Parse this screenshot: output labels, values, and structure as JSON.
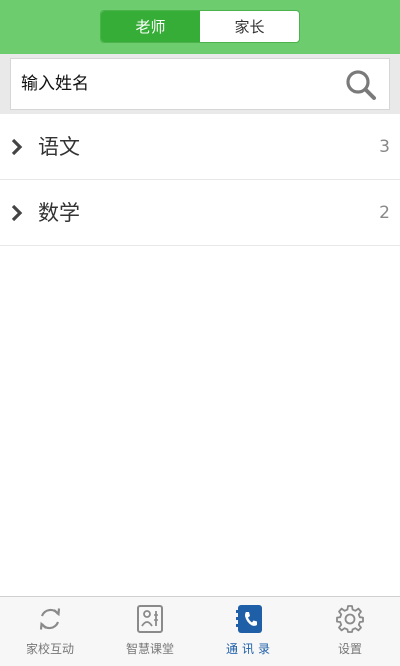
{
  "header": {
    "tabs": [
      {
        "label": "老师",
        "active": true
      },
      {
        "label": "家长",
        "active": false
      }
    ]
  },
  "search": {
    "placeholder": "输入姓名",
    "icon": "search-icon"
  },
  "groups": [
    {
      "label": "语文",
      "count": "3",
      "icon": "chevron-right-icon"
    },
    {
      "label": "数学",
      "count": "2",
      "icon": "chevron-right-icon"
    }
  ],
  "tabbar": {
    "items": [
      {
        "label": "家校互动",
        "icon": "refresh-icon",
        "active": false
      },
      {
        "label": "智慧课堂",
        "icon": "classroom-icon",
        "active": false
      },
      {
        "label": "通讯录",
        "icon": "contacts-phone-icon",
        "active": true
      },
      {
        "label": "设置",
        "icon": "gear-icon",
        "active": false
      }
    ]
  },
  "colors": {
    "header_bg": "#6dcc6d",
    "active_segment": "#36ad36",
    "active_tab": "#1f5fa8"
  }
}
